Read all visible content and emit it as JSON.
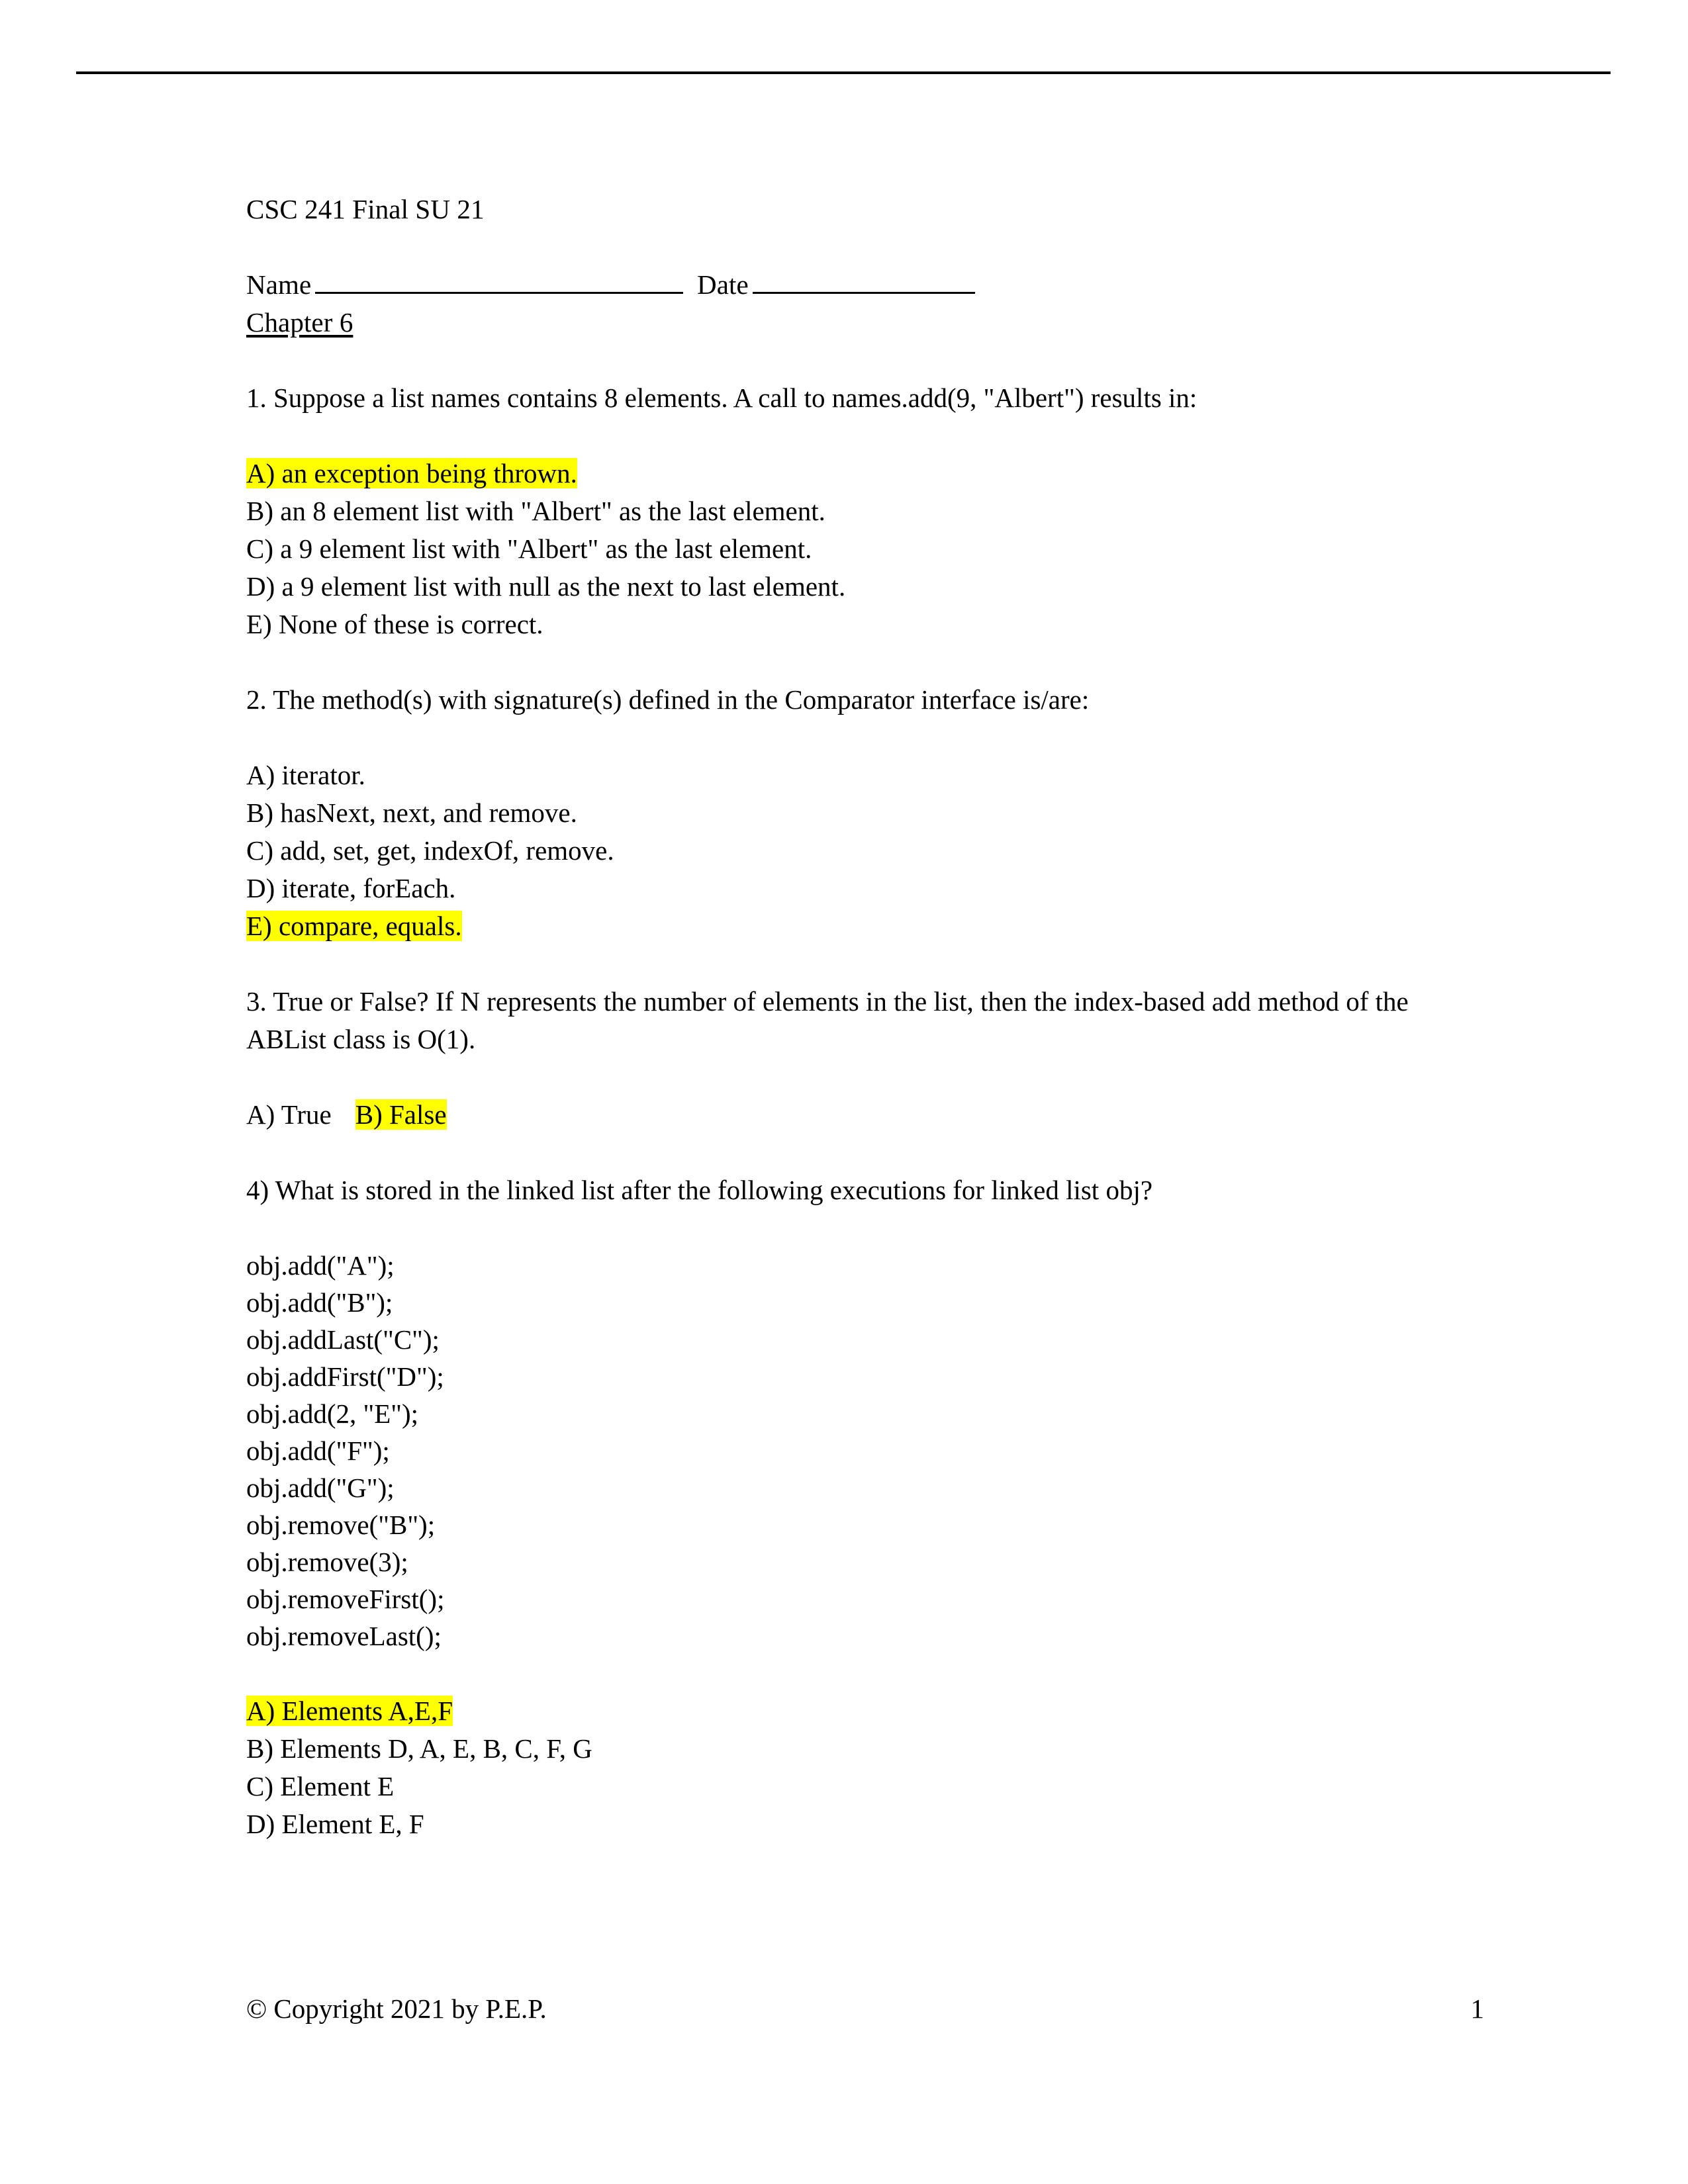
{
  "document": {
    "title": "CSC 241 Final SU 21",
    "name_label": "Name",
    "date_label": "Date",
    "chapter_label": "Chapter 6"
  },
  "questions": [
    {
      "number": "1.",
      "prompt": "1. Suppose a list names contains 8 elements. A call to names.add(9, \"Albert\") results in:",
      "options": [
        {
          "label": "A) an exception being thrown.",
          "highlighted": true
        },
        {
          "label": "B) an 8 element list with \"Albert\" as the last element.",
          "highlighted": false
        },
        {
          "label": "C) a 9 element list with \"Albert\" as the last element.",
          "highlighted": false
        },
        {
          "label": "D) a 9 element list with null as the next to last element.",
          "highlighted": false
        },
        {
          "label": "E) None of these is correct.",
          "highlighted": false
        }
      ]
    },
    {
      "number": "2.",
      "prompt": "2. The method(s) with signature(s) defined in the Comparator interface is/are:",
      "options": [
        {
          "label": "A) iterator.",
          "highlighted": false
        },
        {
          "label": "B) hasNext, next, and remove.",
          "highlighted": false
        },
        {
          "label": "C) add, set, get, indexOf, remove.",
          "highlighted": false
        },
        {
          "label": "D) iterate, forEach.",
          "highlighted": false
        },
        {
          "label": "E) compare, equals.",
          "highlighted": true
        }
      ]
    },
    {
      "number": "3.",
      "prompt": "3. True or False?  If N represents the number of elements in the list, then the index-based add method of the ABList class is O(1).",
      "true_option": "A) True",
      "false_option": "B) False"
    },
    {
      "number": "4)",
      "prompt": "4) What is stored in the linked list after the following executions for linked list obj?",
      "code": [
        "obj.add(\"A\");",
        "obj.add(\"B\");",
        "obj.addLast(\"C\");",
        "obj.addFirst(\"D\");",
        "obj.add(2, \"E\");",
        "obj.add(\"F\");",
        "obj.add(\"G\");",
        "obj.remove(\"B\");",
        "obj.remove(3);",
        "obj.removeFirst();",
        "obj.removeLast();"
      ],
      "options": [
        {
          "label": "A) Elements A,E,F",
          "highlighted": true
        },
        {
          "label": "B) Elements D, A, E, B, C, F, G",
          "highlighted": false
        },
        {
          "label": "C) Element E",
          "highlighted": false
        },
        {
          "label": "D) Element E, F",
          "highlighted": false
        }
      ]
    }
  ],
  "footer": {
    "copyright": "© Copyright 2021 by P.E.P.",
    "page_number": "1"
  },
  "colors": {
    "highlight": "#ffff00",
    "text": "#000000",
    "background": "#ffffff"
  }
}
